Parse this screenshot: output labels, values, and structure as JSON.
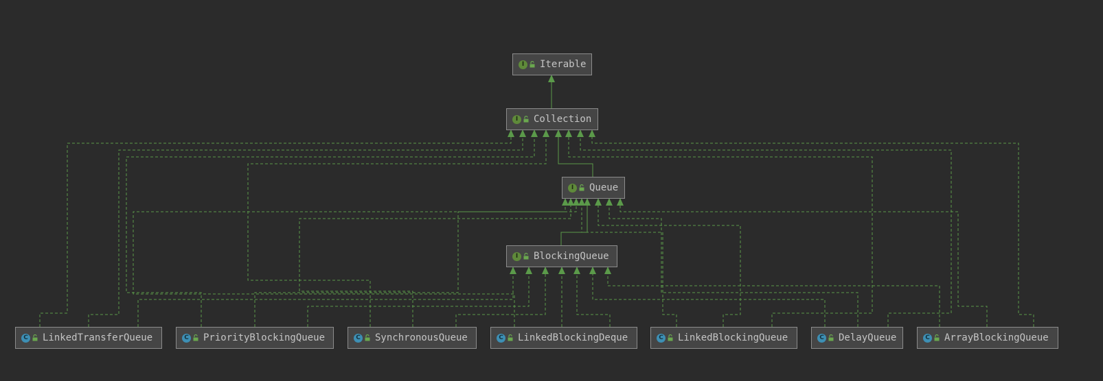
{
  "nodes": {
    "iterable": {
      "label": "Iterable",
      "kind": "I"
    },
    "collection": {
      "label": "Collection",
      "kind": "I"
    },
    "queue": {
      "label": "Queue",
      "kind": "I"
    },
    "blocking_queue": {
      "label": "BlockingQueue",
      "kind": "I"
    },
    "linked_transfer_queue": {
      "label": "LinkedTransferQueue",
      "kind": "C"
    },
    "priority_blocking_queue": {
      "label": "PriorityBlockingQueue",
      "kind": "C"
    },
    "synchronous_queue": {
      "label": "SynchronousQueue",
      "kind": "C"
    },
    "linked_blocking_deque": {
      "label": "LinkedBlockingDeque",
      "kind": "C"
    },
    "linked_blocking_queue": {
      "label": "LinkedBlockingQueue",
      "kind": "C"
    },
    "delay_queue": {
      "label": "DelayQueue",
      "kind": "C"
    },
    "array_blocking_queue": {
      "label": "ArrayBlockingQueue",
      "kind": "C"
    }
  },
  "colors": {
    "background": "#2b2b2b",
    "node_fill": "#454545",
    "node_border": "#8c8c8c",
    "node_text": "#c5c5c5",
    "edge": "#5b9a4a",
    "interface_badge": "#5f8a3a",
    "class_badge": "#3d8fb4"
  }
}
